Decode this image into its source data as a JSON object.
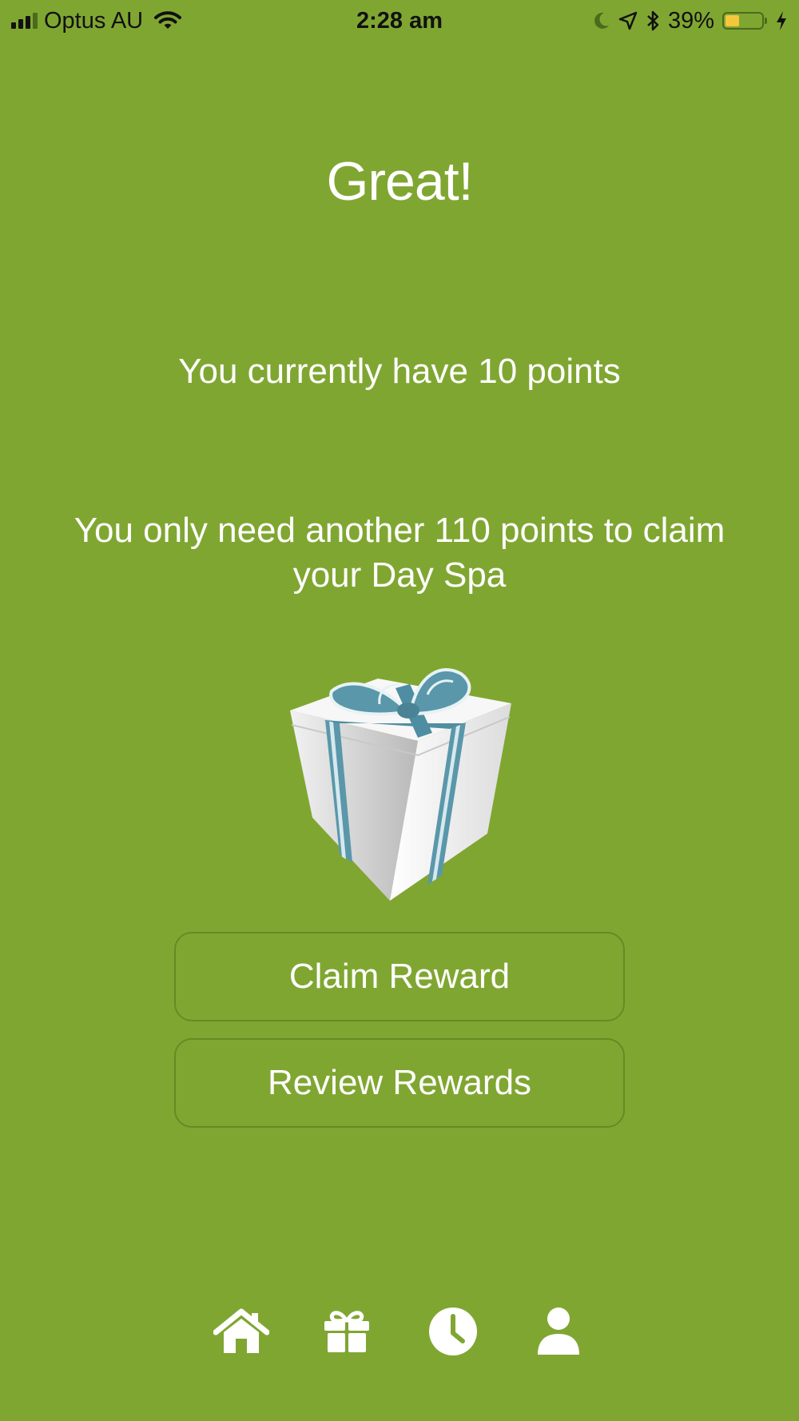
{
  "status_bar": {
    "carrier": "Optus AU",
    "time": "2:28 am",
    "battery_percent": "39%",
    "battery_level": 0.39,
    "icons": [
      "signal-icon",
      "wifi-icon",
      "moon-icon",
      "location-arrow-icon",
      "bluetooth-icon",
      "battery-icon",
      "charging-bolt-icon"
    ]
  },
  "main": {
    "title": "Great!",
    "points_text": "You currently have 10 points",
    "needed_text": "You only need another 110 points to claim your Day Spa",
    "image": "gift-box-image"
  },
  "buttons": {
    "claim_label": "Claim Reward",
    "review_label": "Review Rewards"
  },
  "tab_bar": {
    "items": [
      {
        "icon": "home-icon"
      },
      {
        "icon": "gift-icon"
      },
      {
        "icon": "clock-icon"
      },
      {
        "icon": "user-icon"
      }
    ]
  },
  "colors": {
    "background": "#80a632",
    "button_border": "#678a25",
    "text": "#ffffff",
    "battery_fill": "#f5c73d",
    "ribbon": "#5a97aa"
  }
}
